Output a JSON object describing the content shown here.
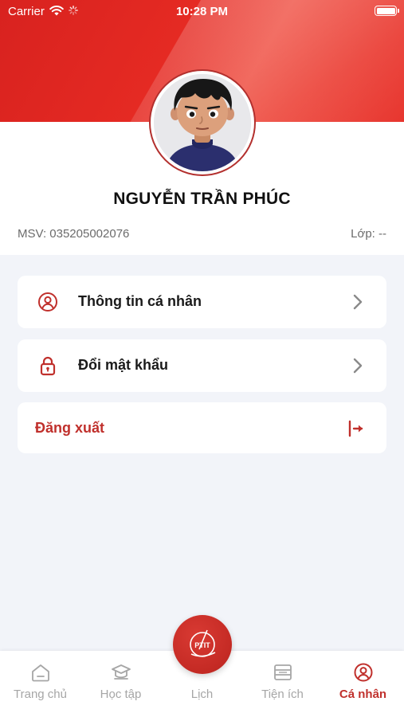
{
  "status_bar": {
    "carrier": "Carrier",
    "time": "10:28 PM"
  },
  "profile": {
    "name": "NGUYỄN TRẦN PHÚC",
    "msv": "MSV: 035205002076",
    "class": "Lớp: --"
  },
  "menu": {
    "personal_info": "Thông tin cá nhân",
    "change_password": "Đổi mật khẩu",
    "logout": "Đăng xuất"
  },
  "bottom_nav": {
    "items": [
      {
        "label": "Trang chủ",
        "icon": "home-icon"
      },
      {
        "label": "Học tập",
        "icon": "graduation-cap-icon"
      },
      {
        "label": "Lịch",
        "icon": "ptit-logo"
      },
      {
        "label": "Tiện ích",
        "icon": "utilities-icon"
      },
      {
        "label": "Cá nhân",
        "icon": "user-circle-icon"
      }
    ],
    "active_index": 4
  },
  "fab_logo_text": "PTIT",
  "colors": {
    "accent": "#c0302c",
    "header_red": "#e02a24",
    "inactive": "#a6a6a6"
  }
}
